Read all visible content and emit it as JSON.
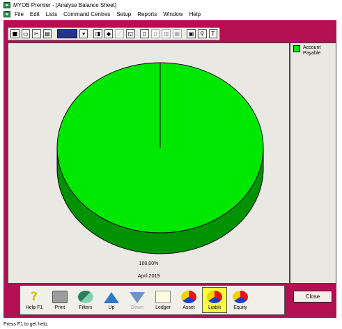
{
  "window": {
    "title": "MYOB Premier - [Analyse Balance Sheet]"
  },
  "menu": [
    "File",
    "Edit",
    "Lists",
    "Command Centres",
    "Setup",
    "Reports",
    "Window",
    "Help"
  ],
  "toolbar": {
    "icons": [
      "save-icon",
      "hide-icon",
      "scissors-icon",
      "printer-icon",
      "color-select-icon",
      "dropdown-icon",
      "chart-type-icon",
      "3d-icon",
      "axis-icon",
      "legend-icon",
      "page-icon",
      "page-icon-2",
      "grid-icon",
      "grid-icon-2",
      "label-icon",
      "magnify-icon",
      "text-icon"
    ]
  },
  "chart": {
    "slice_label": "100,00%",
    "period_label": "April 2019"
  },
  "chart_data": {
    "type": "pie",
    "categories": [
      "Account Payable"
    ],
    "values": [
      100.0
    ],
    "colors": [
      "#00e800"
    ]
  },
  "legend": {
    "items": [
      {
        "label": "Account Payable",
        "color": "#00e800"
      }
    ]
  },
  "buttons": {
    "help": "Help F1",
    "print": "Print",
    "filters": "Filters",
    "up": "Up",
    "down": "Down",
    "ledger": "Ledger",
    "asset": "Asset",
    "liability": "Liabili",
    "equity": "Equity",
    "close": "Close"
  },
  "status": {
    "text": "Press F1 to get help."
  }
}
